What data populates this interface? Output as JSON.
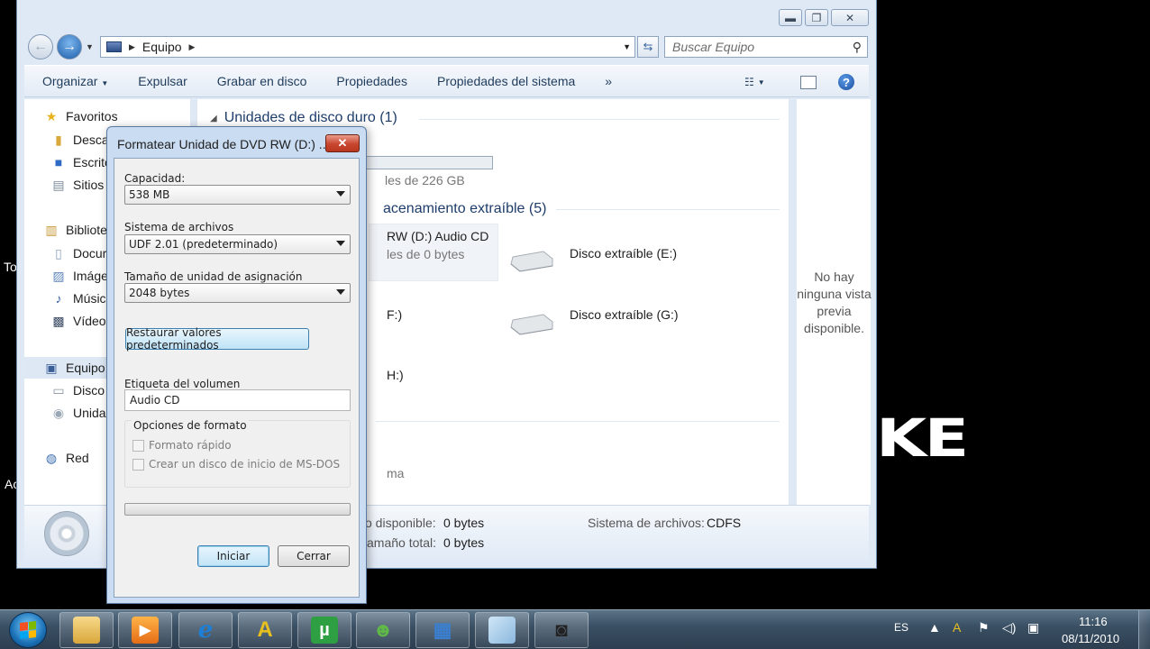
{
  "desktop": {
    "fragment_1": "To",
    "fragment_2": "Ac",
    "logo_text": "KE"
  },
  "explorer": {
    "window_controls": {
      "minimize": "▬",
      "maximize": "❐",
      "close": "✕"
    },
    "address": {
      "root": "Equipo"
    },
    "search_placeholder": "Buscar Equipo",
    "toolbar": {
      "organize": "Organizar",
      "eject": "Expulsar",
      "burn": "Grabar en disco",
      "properties": "Propiedades",
      "system_properties": "Propiedades del sistema",
      "more": "»"
    },
    "nav": {
      "favorites": "Favoritos",
      "downloads": "Desca",
      "desktop": "Escrito",
      "recent": "Sitios",
      "libraries": "Bibliote",
      "documents": "Docur",
      "pictures": "Imáge",
      "music": "Músic",
      "videos": "Vídeo",
      "computer": "Equipo",
      "local_disk": "Disco",
      "dvd_drive": "Unida",
      "network": "Red"
    },
    "content": {
      "hdd_header": "Unidades de disco duro (1)",
      "hdd_free": "les de 226 GB",
      "removable_header": "acenamiento extraíble (5)",
      "dvd_name": "RW (D:) Audio CD",
      "dvd_free": "les de 0 bytes",
      "removable_e": "Disco extraíble (E:)",
      "drive_f": "F:)",
      "removable_g": "Disco extraíble (G:)",
      "drive_h": "H:)",
      "other_item": "ma"
    },
    "preview_text": "No hay ninguna vista previa disponible.",
    "details": {
      "free_label": "o disponible:",
      "free_value": "0 bytes",
      "total_label": "amaño total:",
      "total_value": "0 bytes",
      "fs_label": "Sistema de archivos:",
      "fs_value": "CDFS"
    }
  },
  "dialog": {
    "title": "Formatear Unidad de DVD RW (D:) ...",
    "close": "✕",
    "capacity_label": "Capacidad:",
    "capacity_value": "538 MB",
    "fs_label": "Sistema de archivos",
    "fs_value": "UDF 2.01 (predeterminado)",
    "alloc_label": "Tamaño de unidad de asignación",
    "alloc_value": "2048 bytes",
    "restore_button": "Restaurar valores predeterminados",
    "volume_label": "Etiqueta del volumen",
    "volume_value": "Audio CD",
    "options_title": "Opciones de formato",
    "quick_format": "Formato rápido",
    "msdos_disk": "Crear un disco de inicio de MS-DOS",
    "start_button": "Iniciar",
    "close_button": "Cerrar"
  },
  "taskbar": {
    "language": "ES",
    "time": "11:16",
    "date": "08/11/2010"
  },
  "colors": {
    "accent": "#1d5ea9",
    "close_red": "#c8452e",
    "utorrent_green": "#2ea043"
  }
}
